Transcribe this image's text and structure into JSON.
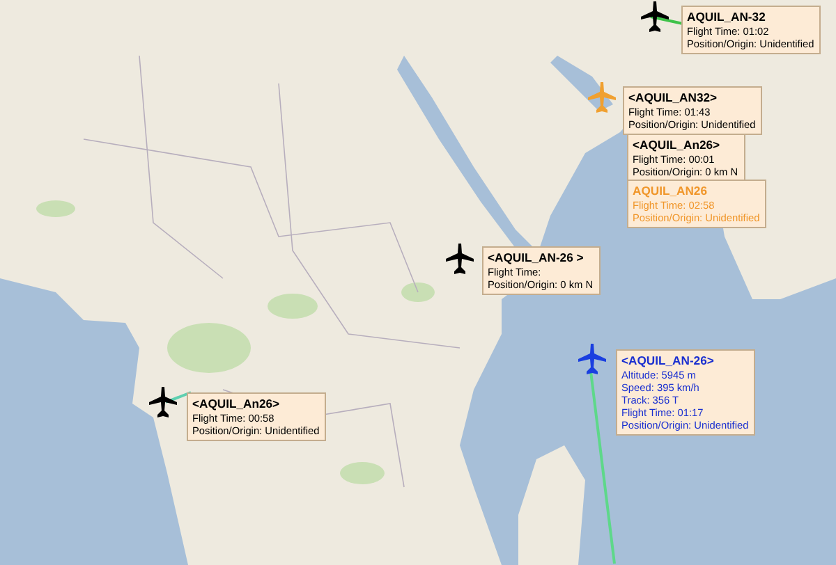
{
  "flights": [
    {
      "title": "AQUIL_AN-32",
      "lines": [
        "Flight Time: 01:02",
        "Position/Origin: Unidentified"
      ],
      "color": "#000000",
      "plane": {
        "color": "#000000"
      }
    },
    {
      "title": "<AQUIL_AN32>",
      "lines": [
        "Flight Time: 01:43",
        "Position/Origin: Unidentified"
      ],
      "color": "#000000",
      "plane": {
        "color": "#f0a030"
      }
    },
    {
      "title": "<AQUIL_An26>",
      "lines": [
        "Flight Time: 00:01",
        "Position/Origin: 0 km N"
      ],
      "color": "#000000"
    },
    {
      "title": "AQUIL_AN26",
      "lines": [
        "Flight Time: 02:58",
        "Position/Origin: Unidentified"
      ],
      "color": "#f0962a"
    },
    {
      "title": "<AQUIL_AN-26 >",
      "lines": [
        "Flight Time:",
        "Position/Origin: 0 km N"
      ],
      "color": "#000000",
      "plane": {
        "color": "#000000"
      }
    },
    {
      "title": "<AQUIL_AN-26>",
      "lines": [
        "Altitude: 5945 m",
        "Speed: 395 km/h",
        "Track: 356 T",
        "Flight Time: 01:17",
        "Position/Origin: Unidentified"
      ],
      "color": "#1a2fd0",
      "plane": {
        "color": "#1a3fe0"
      }
    },
    {
      "title": "<AQUIL_An26>",
      "lines": [
        "Flight Time: 00:58",
        "Position/Origin: Unidentified"
      ],
      "color": "#000000",
      "plane": {
        "color": "#000000"
      }
    }
  ]
}
